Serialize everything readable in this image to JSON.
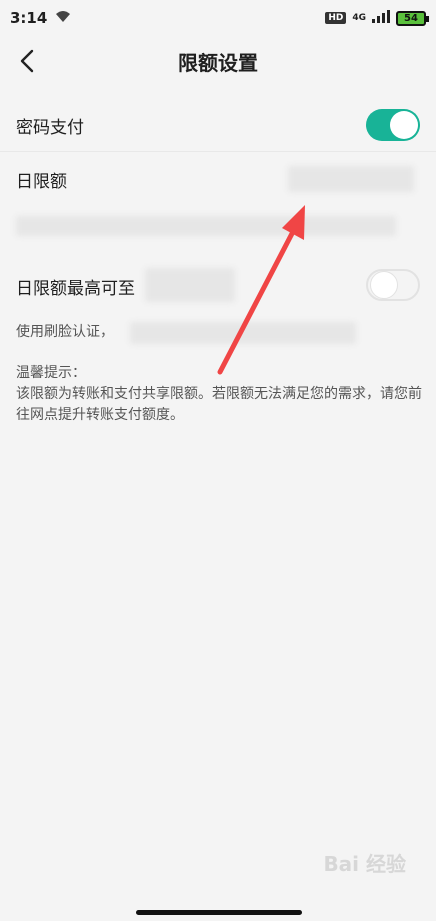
{
  "status": {
    "time": "3:14",
    "hd": "HD",
    "network": "4G",
    "battery": "54"
  },
  "header": {
    "title": "限额设置"
  },
  "rows": {
    "password_pay": "密码支付",
    "daily_limit": "日限额",
    "daily_max": "日限额最高可至"
  },
  "notes": {
    "face_auth": "使用刷脸认证，",
    "tip_title": "温馨提示：",
    "tip_body": "该限额为转账和支付共享限额。若限额无法满足您的需求，请您前往网点提升转账支付额度。"
  },
  "toggles": {
    "password_pay_on": true,
    "daily_max_on": false,
    "accent_color": "#18b397"
  },
  "watermark": "Bai 经验"
}
